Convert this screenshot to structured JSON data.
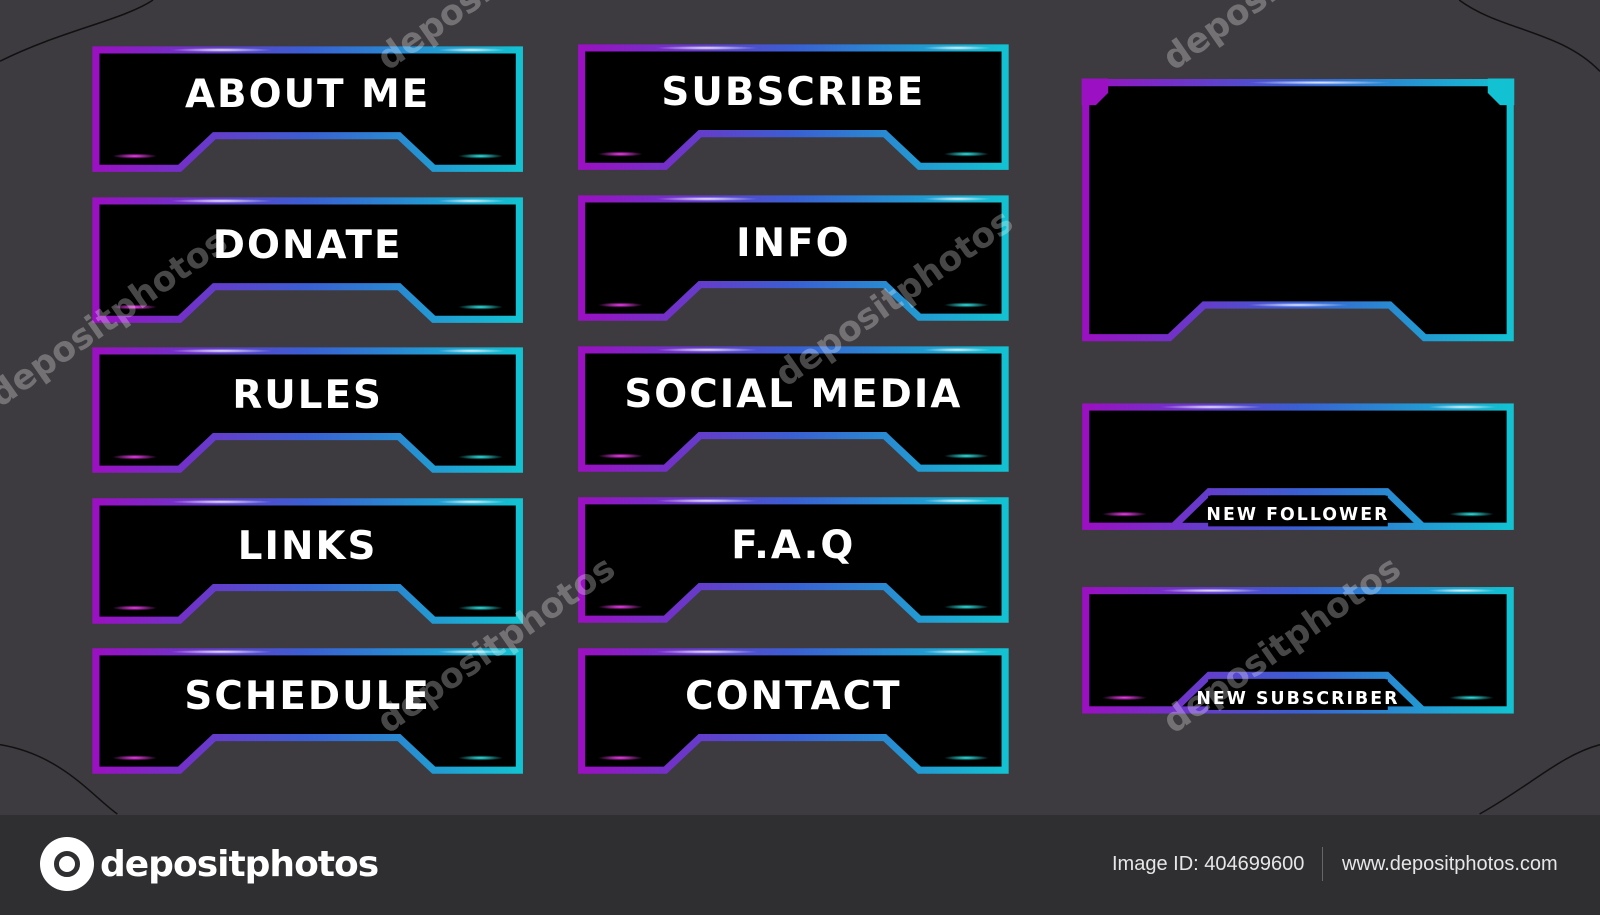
{
  "colors": {
    "background": "#3d3b3f",
    "footer": "#2f2e31",
    "gradient_start": "#9a10c2",
    "gradient_mid": "#3a5fd2",
    "gradient_end": "#12c2d2",
    "panel_fill": "#000000"
  },
  "buttons": [
    {
      "label": "ABOUT ME"
    },
    {
      "label": "DONATE"
    },
    {
      "label": "RULES"
    },
    {
      "label": "LINKS"
    },
    {
      "label": "SCHEDULE"
    },
    {
      "label": "SUBSCRIBE"
    },
    {
      "label": "INFO"
    },
    {
      "label": "SOCIAL MEDIA"
    },
    {
      "label": "F.A.Q"
    },
    {
      "label": "CONTACT"
    }
  ],
  "alerts": [
    {
      "label": "NEW FOLLOWER"
    },
    {
      "label": "NEW SUBSCRIBER"
    }
  ],
  "watermark": {
    "text": "depositphotos"
  },
  "footer": {
    "logo_text": "depositphotos",
    "image_id": "Image ID: 404699600",
    "site": "www.depositphotos.com"
  }
}
